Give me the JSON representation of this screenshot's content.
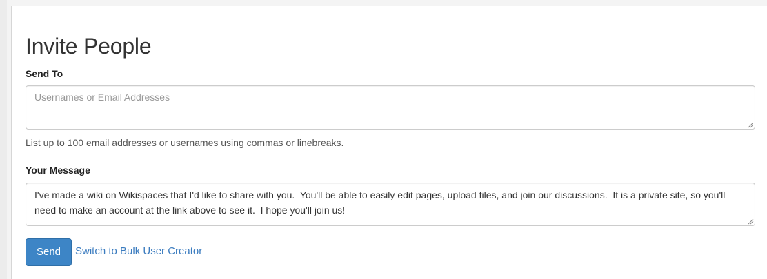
{
  "form": {
    "title": "Invite People",
    "send_to": {
      "label": "Send To",
      "placeholder": "Usernames or Email Addresses",
      "value": "",
      "help": "List up to 100 email addresses or usernames using commas or linebreaks."
    },
    "message": {
      "label": "Your Message",
      "value": "I've made a wiki on Wikispaces that I'd like to share with you.  You'll be able to easily edit pages, upload files, and join our discussions.  It is a private site, so you'll need to make an account at the link above to see it.  I hope you'll join us!"
    },
    "send_label": "Send",
    "bulk_link_label": "Switch to Bulk User Creator"
  },
  "colors": {
    "primary_button": "#3d85c6",
    "link": "#3a7bbf",
    "placeholder": "#999999"
  }
}
